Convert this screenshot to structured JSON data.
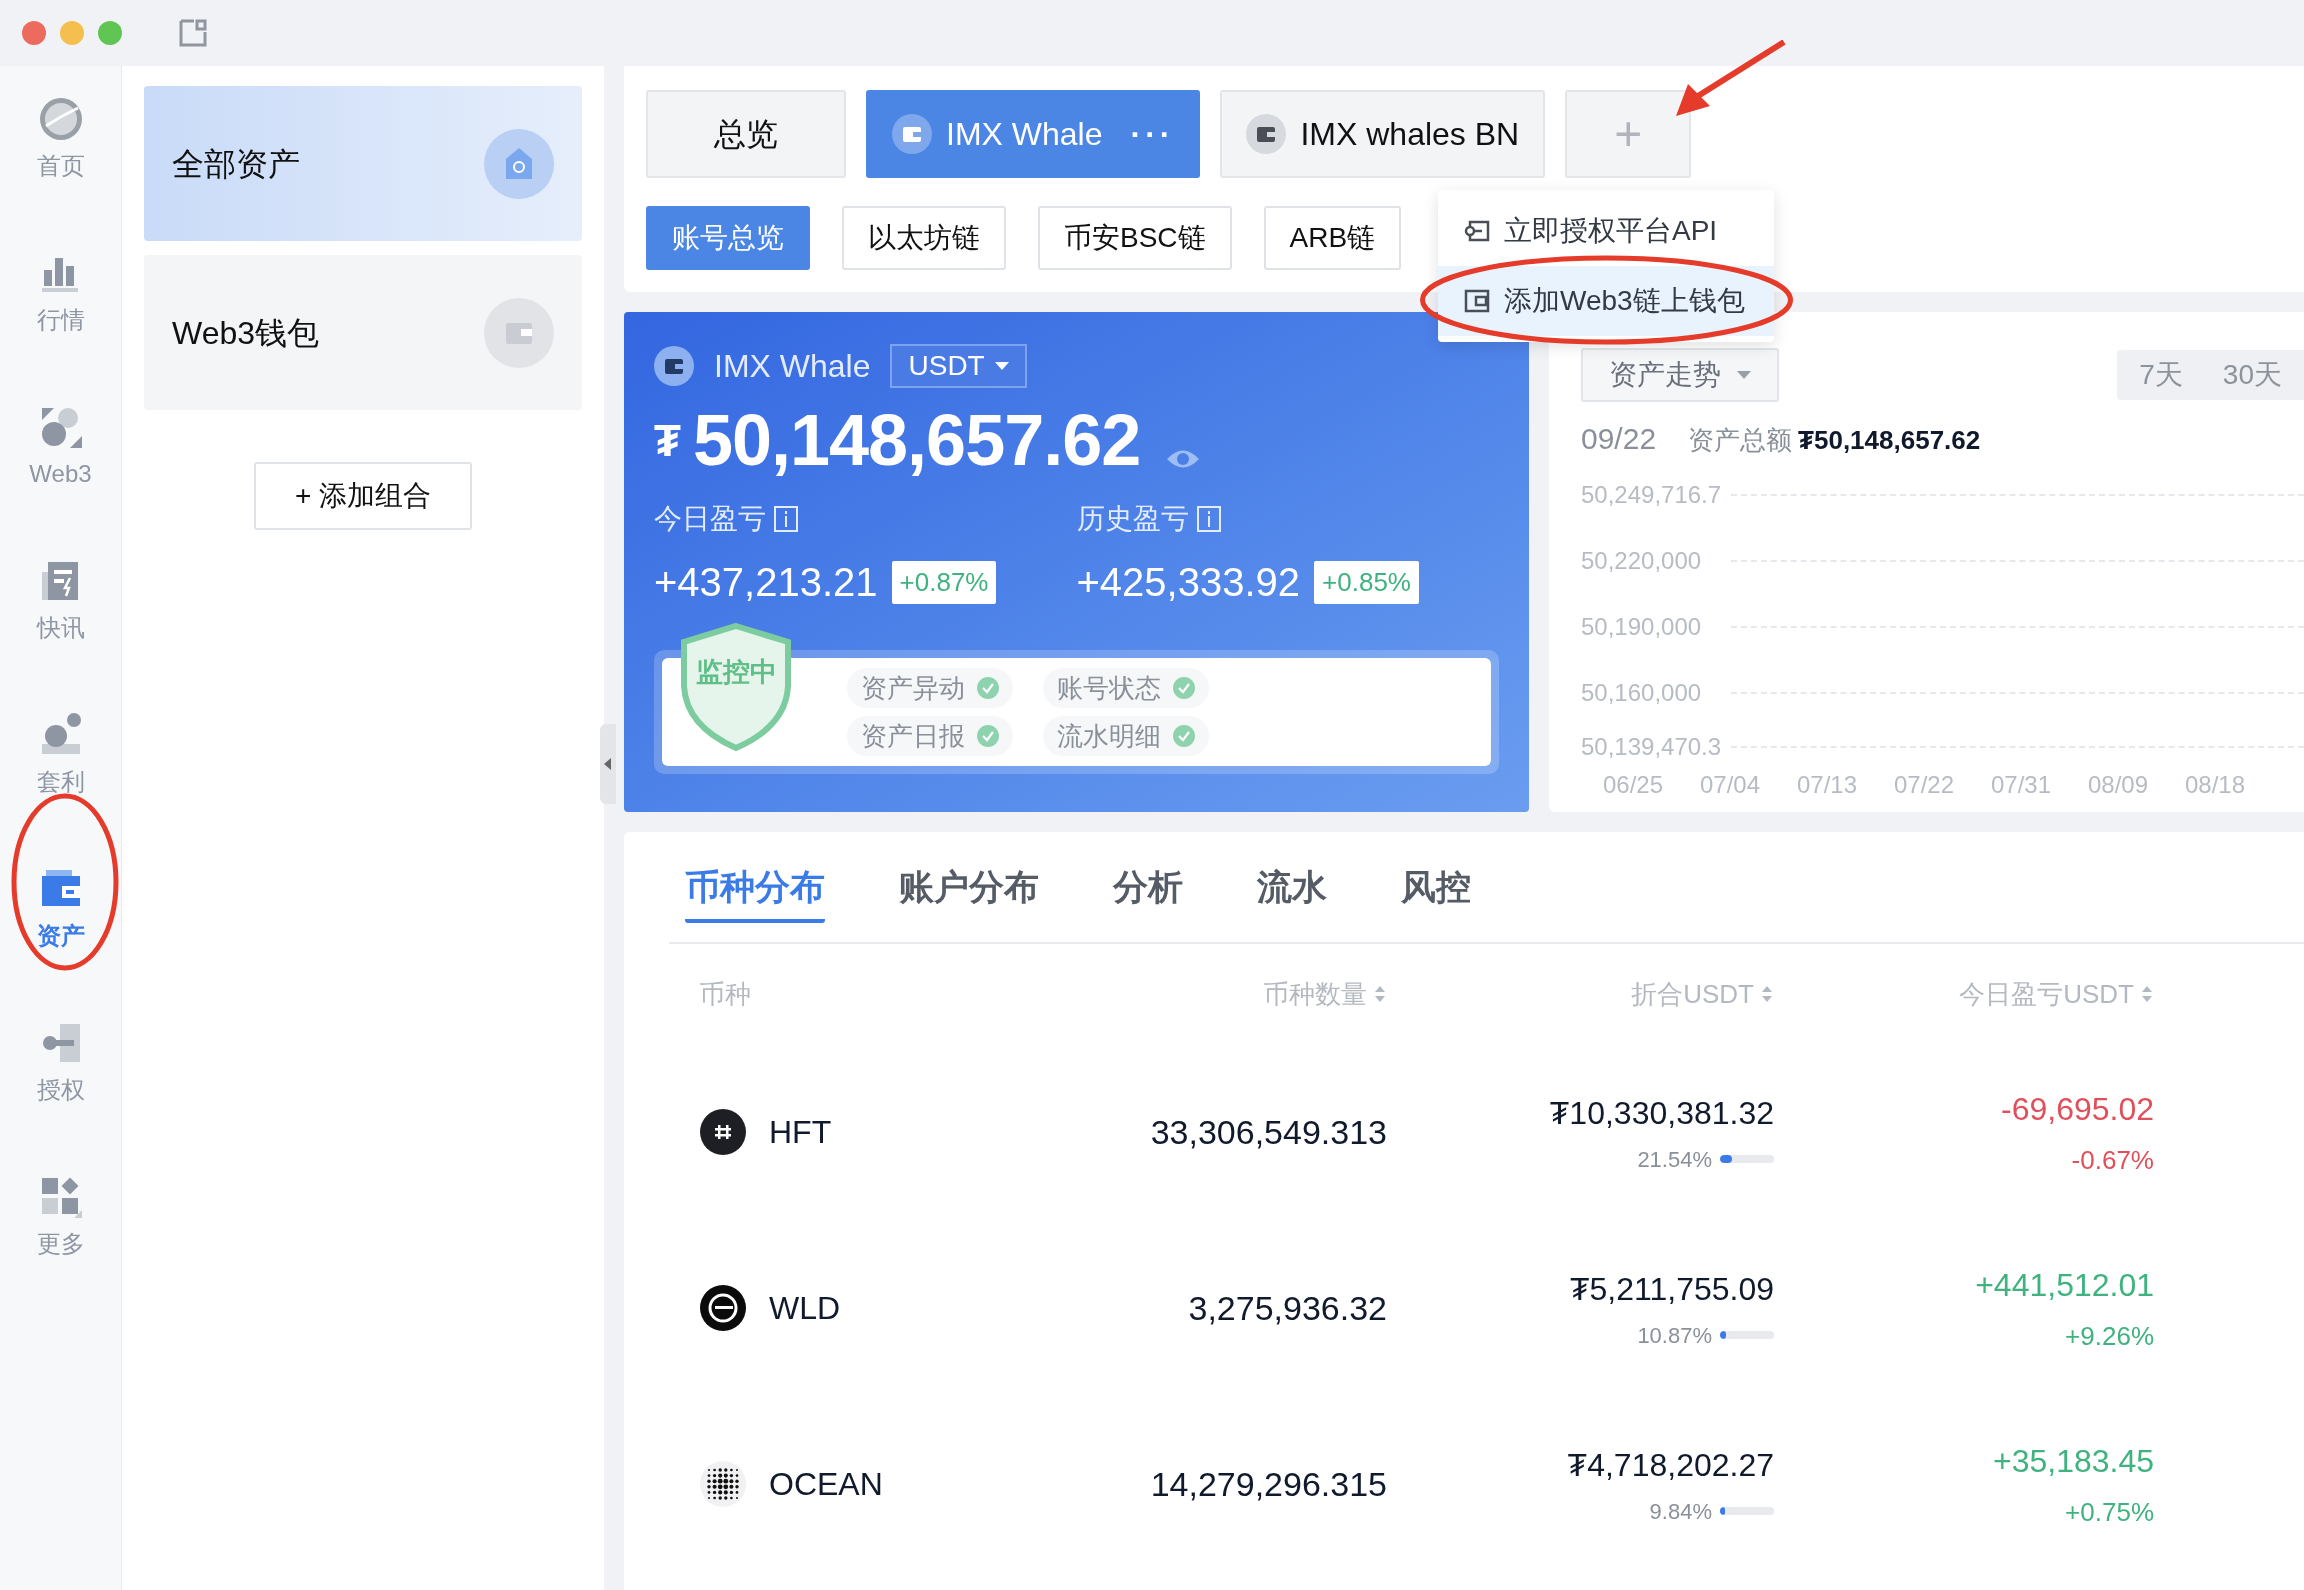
{
  "nav": [
    {
      "label": "首页",
      "kind": "home",
      "selected": false
    },
    {
      "label": "行情",
      "kind": "market",
      "selected": false
    },
    {
      "label": "Web3",
      "kind": "web3",
      "selected": false
    },
    {
      "label": "快讯",
      "kind": "news",
      "selected": false
    },
    {
      "label": "套利",
      "kind": "arbitrage",
      "selected": false
    },
    {
      "label": "资产",
      "kind": "assets",
      "selected": true
    },
    {
      "label": "授权",
      "kind": "auth",
      "selected": false
    },
    {
      "label": "更多",
      "kind": "more",
      "selected": false
    }
  ],
  "portfolios": [
    {
      "label": "全部资产",
      "kind": "all",
      "selected": true
    },
    {
      "label": "Web3钱包",
      "kind": "wallet",
      "selected": false
    }
  ],
  "add_portfolio": "+ 添加组合",
  "account_tabs": [
    {
      "label": "总览",
      "kind": "plain",
      "selected": false
    },
    {
      "label": "IMX Whale",
      "kind": "wallet",
      "selected": true,
      "more": "···"
    },
    {
      "label": "IMX whales BN",
      "kind": "wallet",
      "selected": false
    }
  ],
  "add_tab": "+",
  "chain_tabs": [
    {
      "label": "账号总览",
      "selected": true
    },
    {
      "label": "以太坊链",
      "selected": false
    },
    {
      "label": "币安BSC链",
      "selected": false
    },
    {
      "label": "ARB链",
      "selected": false
    }
  ],
  "menu": [
    {
      "label": "立即授权平台API",
      "kind": "api",
      "selected": false
    },
    {
      "label": "添加Web3链上钱包",
      "kind": "wallet",
      "selected": true
    }
  ],
  "summary": {
    "name": "IMX Whale",
    "currency": "USDT",
    "symbol": "₮",
    "total": "50,148,657.62",
    "stats": [
      {
        "label": "今日盈亏",
        "value": "+437,213.21",
        "pct": "+0.87%"
      },
      {
        "label": "历史盈亏",
        "value": "+425,333.92",
        "pct": "+0.85%"
      }
    ],
    "monitor": "监控中",
    "checks": [
      {
        "label": "资产异动",
        "on": true
      },
      {
        "label": "账号状态",
        "on": true
      },
      {
        "label": "资产日报",
        "on": true
      },
      {
        "label": "流水明细",
        "on": true
      }
    ]
  },
  "trend": {
    "select": "资产走势",
    "ranges": [
      {
        "label": "7天",
        "selected": false
      },
      {
        "label": "30天",
        "selected": false
      }
    ],
    "date": "09/22",
    "total_label": "资产总额",
    "total": "₮50,148,657.62",
    "y_labels": [
      "50,249,716.7",
      "50,220,000",
      "50,190,000",
      "50,160,000",
      "50,139,470.3"
    ],
    "x_labels": [
      "06/25",
      "07/04",
      "07/13",
      "07/22",
      "07/31",
      "08/09",
      "08/18"
    ]
  },
  "detail_tabs": [
    {
      "label": "币种分布",
      "selected": true
    },
    {
      "label": "账户分布",
      "selected": false
    },
    {
      "label": "分析",
      "selected": false
    },
    {
      "label": "流水",
      "selected": false
    },
    {
      "label": "风控",
      "selected": false
    }
  ],
  "table": {
    "columns": [
      {
        "label": "币种",
        "sortable": false
      },
      {
        "label": "币种数量",
        "sortable": true
      },
      {
        "label": "折合USDT",
        "sortable": true
      },
      {
        "label": "今日盈亏USDT",
        "sortable": true
      }
    ],
    "rows": [
      {
        "coin": "HFT",
        "kind": "hft",
        "quantity": "33,306,549.313",
        "value": "₮10,330,381.32",
        "share": "21.54%",
        "level": 0.2154,
        "pnl": "-69,695.02",
        "pnl_pct": "-0.67%",
        "color": "#e0505a"
      },
      {
        "coin": "WLD",
        "kind": "wld",
        "quantity": "3,275,936.32",
        "value": "₮5,211,755.09",
        "share": "10.87%",
        "level": 0.1087,
        "pnl": "+441,512.01",
        "pnl_pct": "+9.26%",
        "color": "#3fb27f"
      },
      {
        "coin": "OCEAN",
        "kind": "ocean",
        "quantity": "14,279,296.315",
        "value": "₮4,718,202.27",
        "share": "9.84%",
        "level": 0.0984,
        "pnl": "+35,183.45",
        "pnl_pct": "+0.75%",
        "color": "#3fb27f"
      }
    ]
  }
}
